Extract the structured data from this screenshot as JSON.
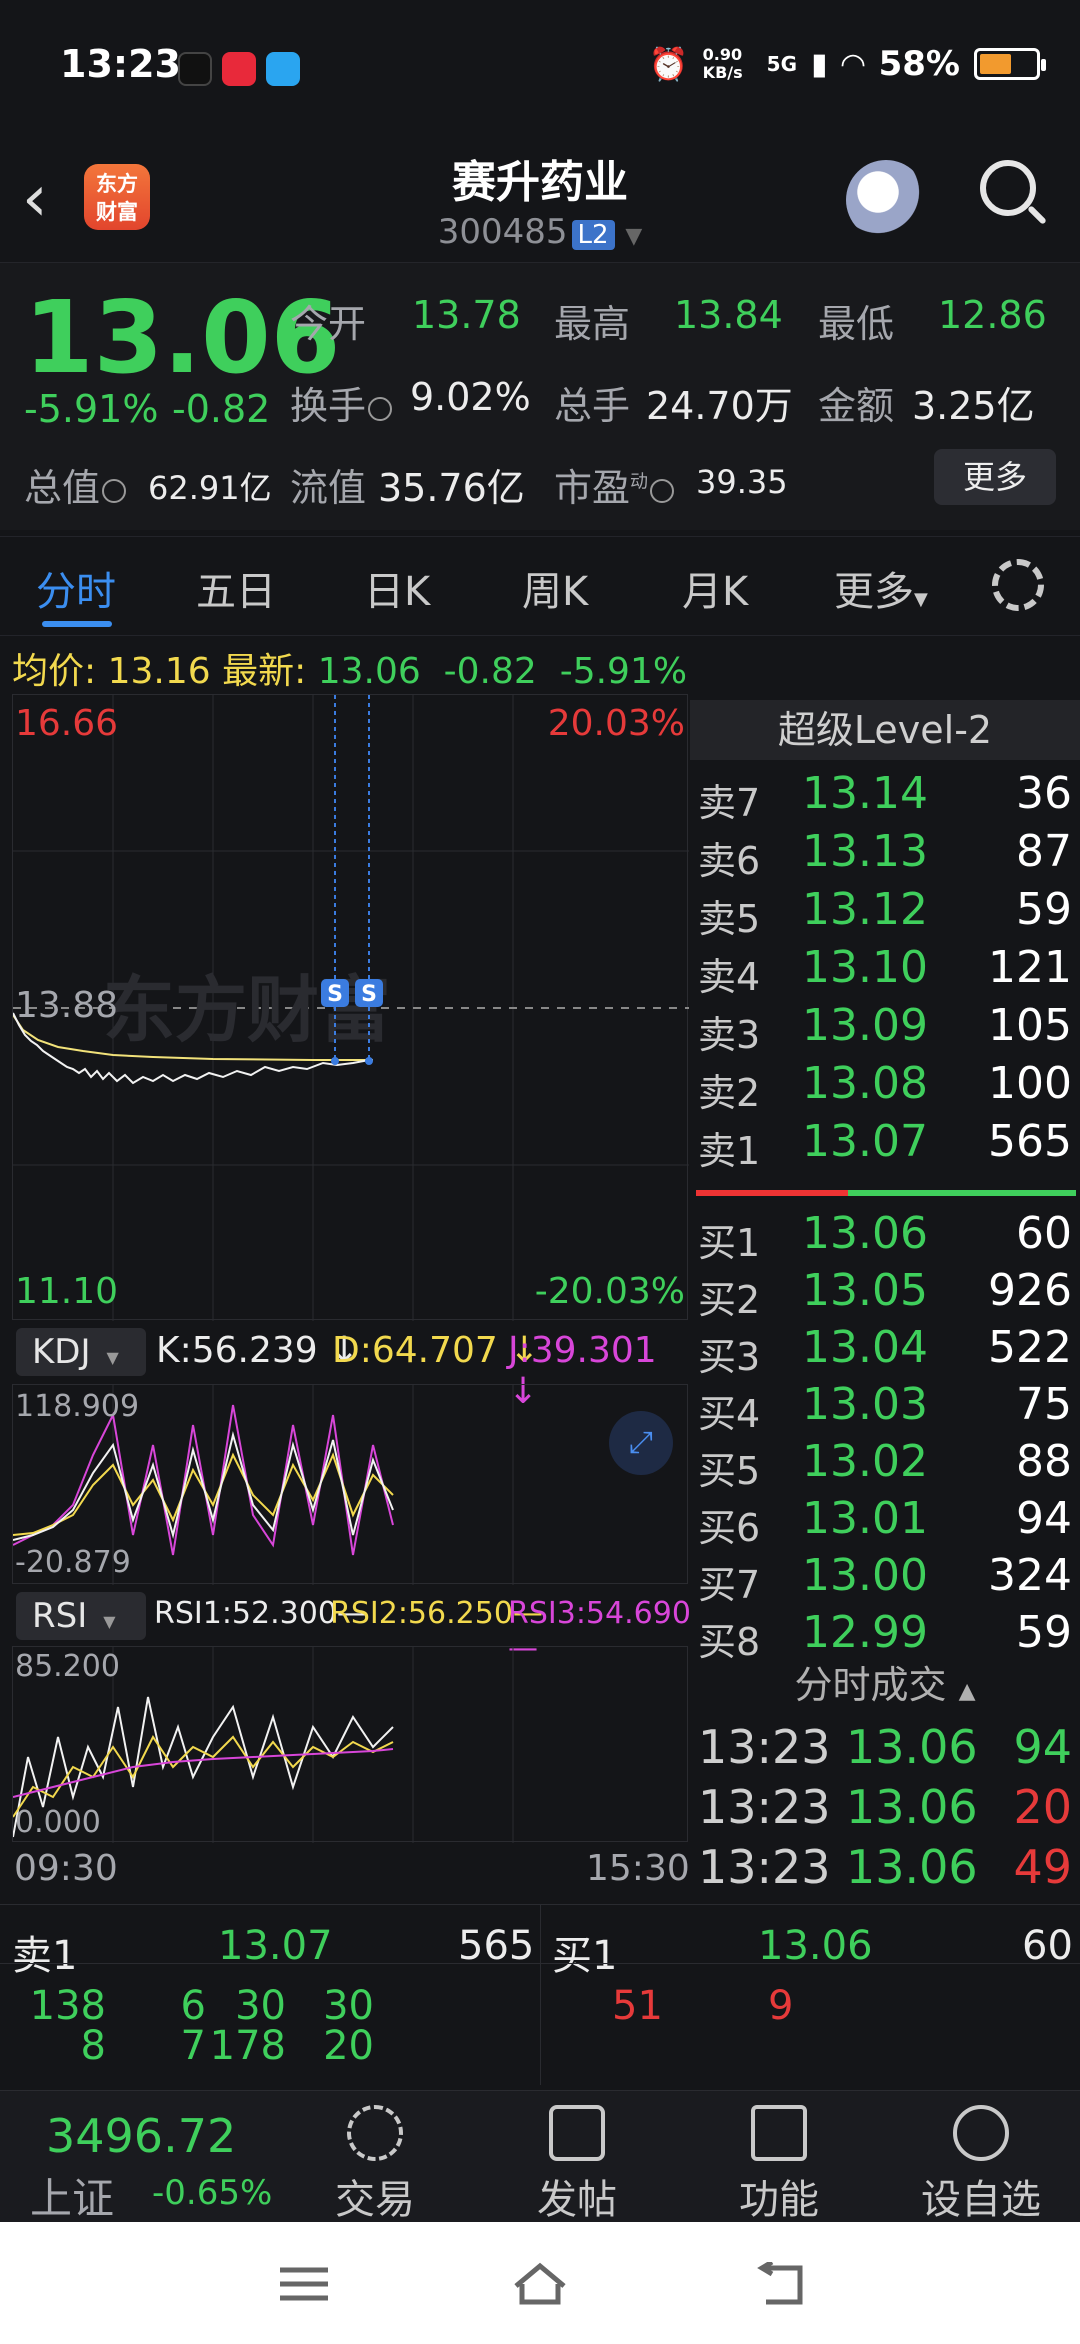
{
  "status": {
    "time": "13:23",
    "net_speed": "0.90 KB/s",
    "signal": "5G",
    "battery": "58%",
    "battery_level": 0.58
  },
  "header": {
    "logo_line1": "东方",
    "logo_line2": "财富",
    "title": "赛升药业",
    "code": "300485",
    "badge": "L2"
  },
  "quote": {
    "price": "13.06",
    "pct": "-5.91%",
    "chg": "-0.82",
    "open_label": "今开",
    "open": "13.78",
    "high_label": "最高",
    "high": "13.84",
    "low_label": "最低",
    "low": "12.86",
    "turnover_label": "换手",
    "turnover": "9.02%",
    "volume_label": "总手",
    "volume": "24.70万",
    "amount_label": "金额",
    "amount": "3.25亿",
    "mktcap_label": "总值",
    "mktcap": "62.91亿",
    "float_label": "流值",
    "float": "35.76亿",
    "pe_label": "市盈",
    "pe_sup": "动",
    "pe": "39.35",
    "more": "更多"
  },
  "tabs": [
    "分时",
    "五日",
    "日K",
    "周K",
    "月K",
    "更多"
  ],
  "avg": {
    "avg_label": "均价:",
    "avg": "13.16",
    "latest_label": "最新:",
    "latest": "13.06",
    "chg": "-0.82",
    "pct": "-5.91%"
  },
  "chart": {
    "top_price": "16.66",
    "top_pct": "20.03%",
    "mid_price": "13.88",
    "bot_price": "11.10",
    "bot_pct": "-20.03%",
    "watermark": "东方财富",
    "marker": "S",
    "kdj_label": "KDJ",
    "k": "K:56.239 ↓",
    "d": "D:64.707 ↓",
    "j": "J:39.301 ↓",
    "kdj_max": "118.909",
    "kdj_min": "-20.879",
    "rsi_label": "RSI",
    "rsi1": "RSI1:52.300—",
    "rsi2": "RSI2:56.250—",
    "rsi3": "RSI3:54.690—",
    "rsi_max": "85.200",
    "rsi_min": "0.000",
    "t_start": "09:30",
    "t_end": "15:30"
  },
  "level2": {
    "title": "超级Level-2",
    "asks": [
      {
        "label": "卖7",
        "price": "13.14",
        "vol": "36"
      },
      {
        "label": "卖6",
        "price": "13.13",
        "vol": "87"
      },
      {
        "label": "卖5",
        "price": "13.12",
        "vol": "59"
      },
      {
        "label": "卖4",
        "price": "13.10",
        "vol": "121"
      },
      {
        "label": "卖3",
        "price": "13.09",
        "vol": "105"
      },
      {
        "label": "卖2",
        "price": "13.08",
        "vol": "100"
      },
      {
        "label": "卖1",
        "price": "13.07",
        "vol": "565"
      }
    ],
    "bids": [
      {
        "label": "买1",
        "price": "13.06",
        "vol": "60"
      },
      {
        "label": "买2",
        "price": "13.05",
        "vol": "926"
      },
      {
        "label": "买3",
        "price": "13.04",
        "vol": "522"
      },
      {
        "label": "买4",
        "price": "13.03",
        "vol": "75"
      },
      {
        "label": "买5",
        "price": "13.02",
        "vol": "88"
      },
      {
        "label": "买6",
        "price": "13.01",
        "vol": "94"
      },
      {
        "label": "买7",
        "price": "13.00",
        "vol": "324"
      },
      {
        "label": "买8",
        "price": "12.99",
        "vol": "59"
      }
    ],
    "ticks_title": "分时成交",
    "ticks": [
      {
        "time": "13:23",
        "price": "13.06",
        "vol": "94"
      },
      {
        "time": "13:23",
        "price": "13.06",
        "vol": "20"
      },
      {
        "time": "13:23",
        "price": "13.06",
        "vol": "49"
      }
    ]
  },
  "strip": {
    "ask_label": "卖1",
    "ask_price": "13.07",
    "ask_vol": "565",
    "bid_label": "买1",
    "bid_price": "13.06",
    "bid_vol": "60",
    "ask_queue": [
      "138",
      "6",
      "30",
      "30",
      "8",
      "7",
      "178",
      "20"
    ],
    "bid_queue": [
      "51",
      "9"
    ]
  },
  "nav": {
    "index_value": "3496.72",
    "index_name": "上证",
    "index_pct": "-0.65%",
    "items": [
      "交易",
      "发帖",
      "功能",
      "设自选"
    ]
  }
}
